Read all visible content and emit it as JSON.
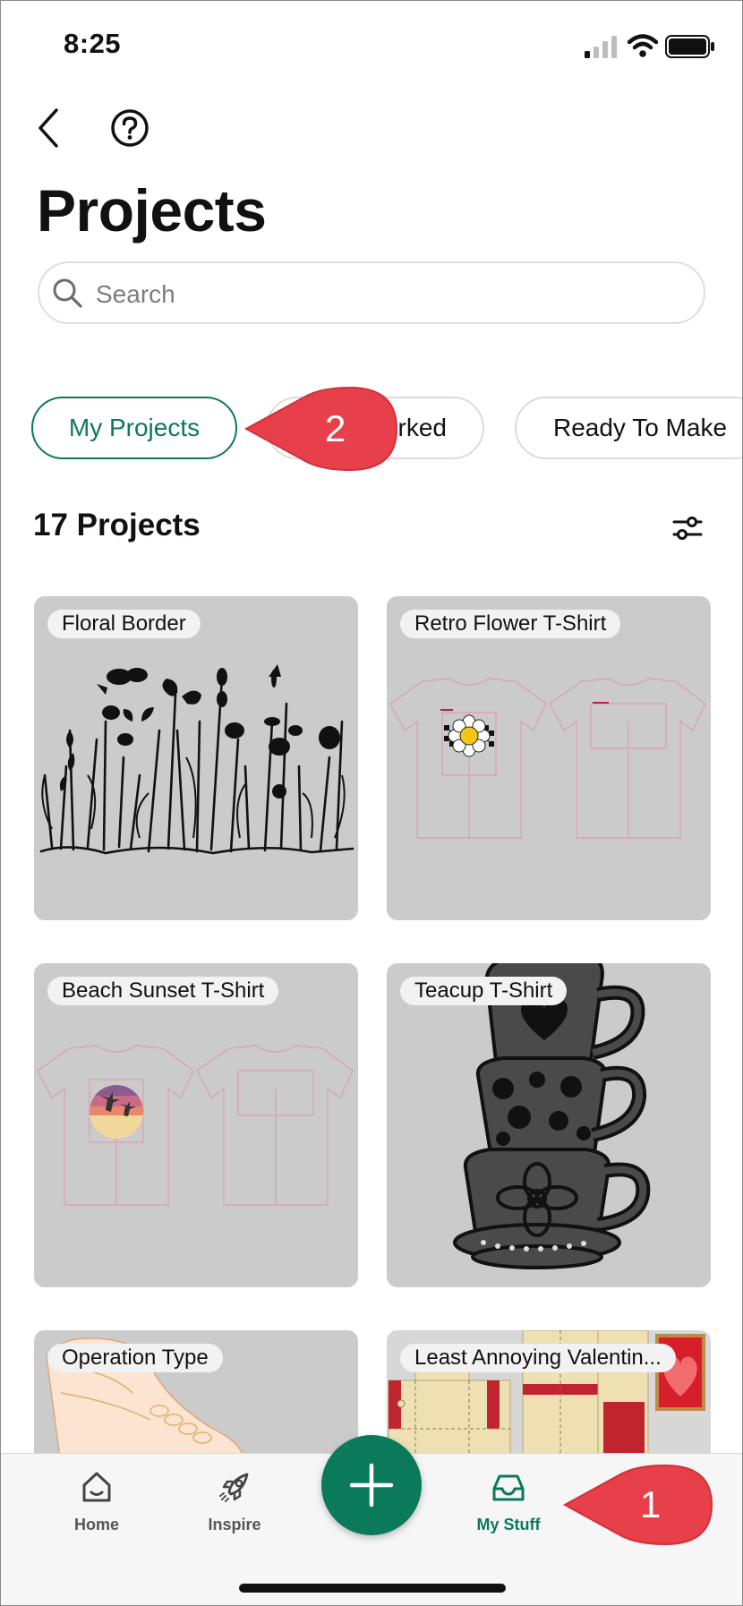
{
  "status_bar": {
    "time": "8:25"
  },
  "header": {
    "title": "Projects"
  },
  "search": {
    "placeholder": "Search"
  },
  "filter_chips": [
    {
      "label": "My Projects",
      "active": true
    },
    {
      "label": "rked",
      "active": false
    },
    {
      "label": "Ready To Make",
      "active": false
    }
  ],
  "project_count": "17 Projects",
  "projects": [
    {
      "title": "Floral Border"
    },
    {
      "title": "Retro Flower T-Shirt"
    },
    {
      "title": "Beach Sunset T-Shirt"
    },
    {
      "title": "Teacup T-Shirt"
    },
    {
      "title": "Operation Type"
    },
    {
      "title": "Least Annoying Valentin..."
    }
  ],
  "bottom_nav": {
    "items": [
      {
        "label": "Home",
        "icon": "home-icon"
      },
      {
        "label": "Inspire",
        "icon": "rocket-icon"
      },
      {
        "label": "My Stuff",
        "icon": "inbox-icon",
        "active": true
      }
    ],
    "fab_icon": "plus-icon"
  },
  "annotations": {
    "callout_1": "1",
    "callout_2": "2",
    "color": "#e8404a"
  },
  "colors": {
    "accent": "#0b7a5a",
    "card_bg": "#cbcbcb"
  }
}
